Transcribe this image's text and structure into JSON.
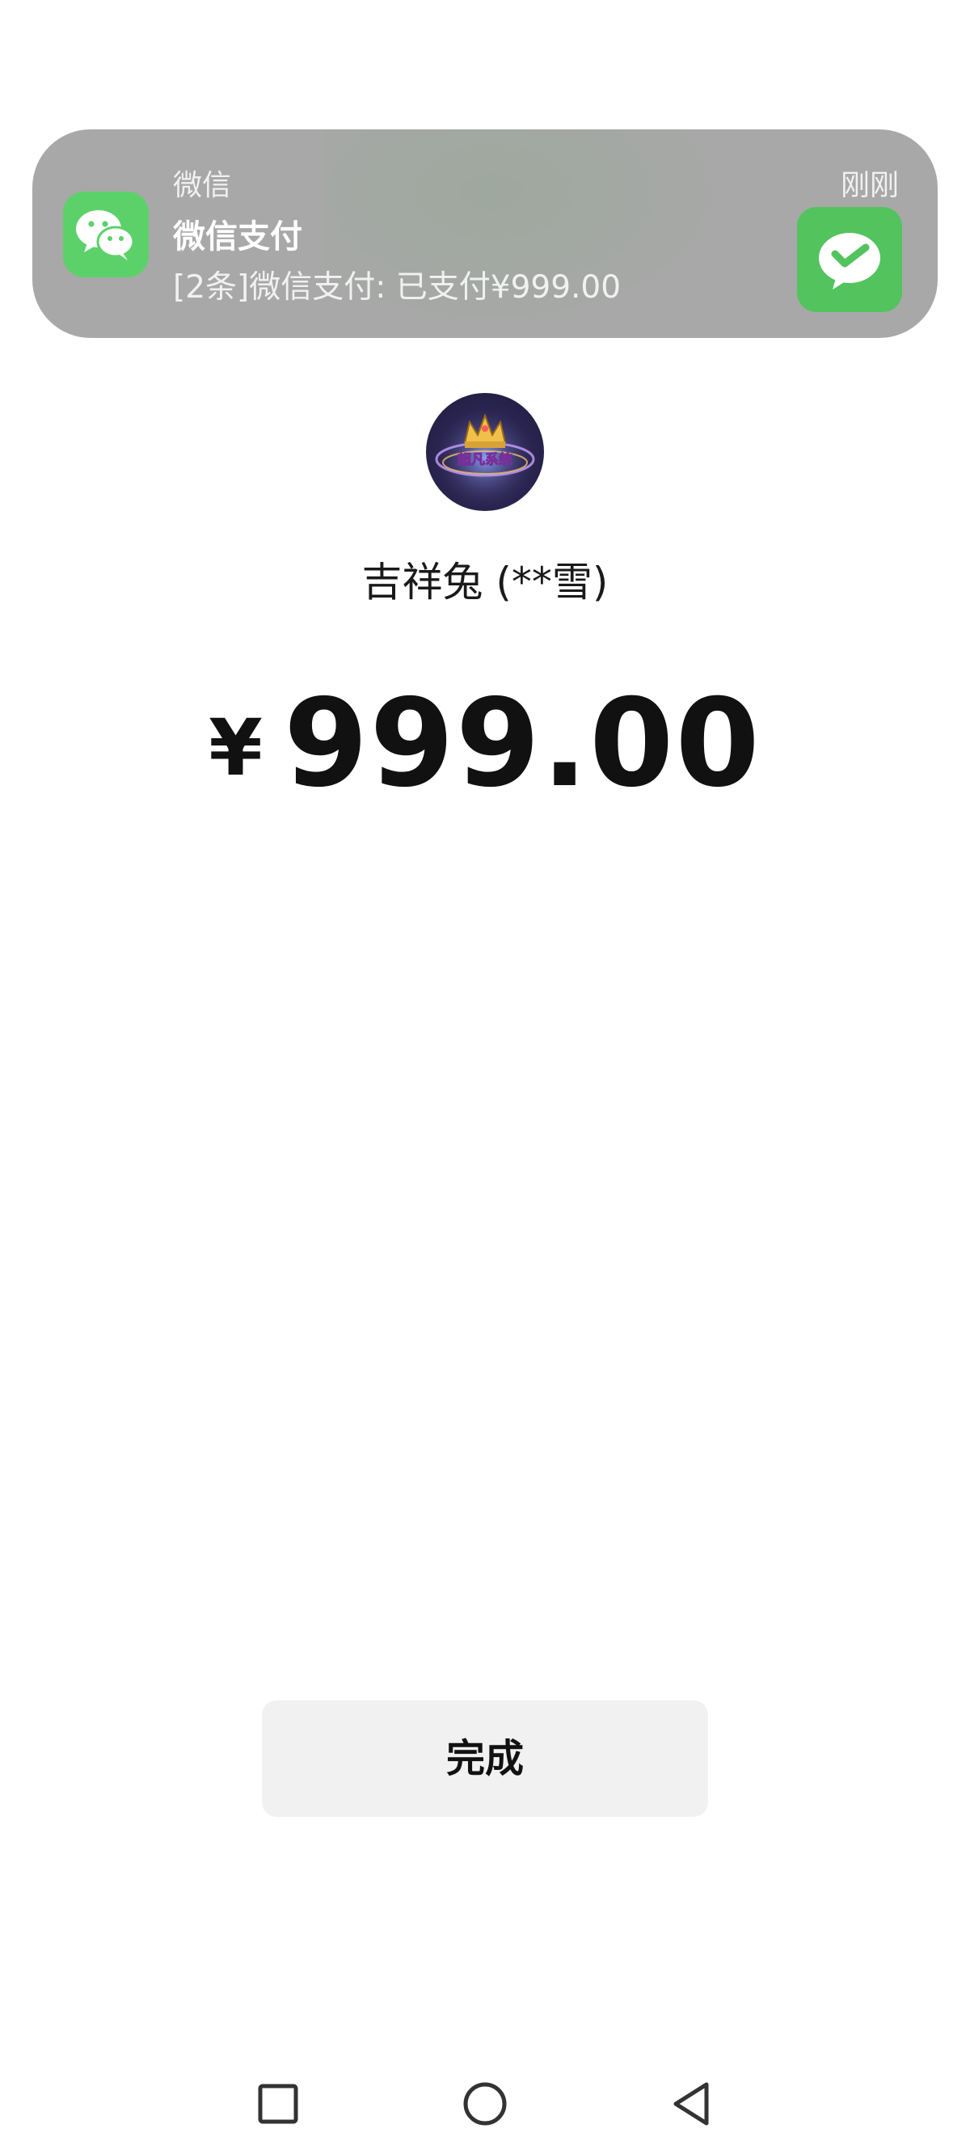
{
  "notification": {
    "app_name": "微信",
    "title": "微信支付",
    "body": "[2条]微信支付: 已支付¥999.00",
    "time": "刚刚",
    "app_icon": "wechat-icon",
    "pay_icon": "wechat-pay-icon"
  },
  "merchant": {
    "avatar_icon": "avatar-image",
    "avatar_text": "超凡系统",
    "name": "吉祥兔 (**雪)"
  },
  "payment": {
    "currency_symbol": "¥",
    "amount": "999.00"
  },
  "actions": {
    "done_label": "完成"
  },
  "navbar": {
    "recents_icon": "square-icon",
    "home_icon": "circle-icon",
    "back_icon": "triangle-back-icon"
  },
  "colors": {
    "wechat_green": "#5cd16a",
    "banner_gray": "#a8a8a8",
    "button_bg": "#f1f1f1"
  }
}
